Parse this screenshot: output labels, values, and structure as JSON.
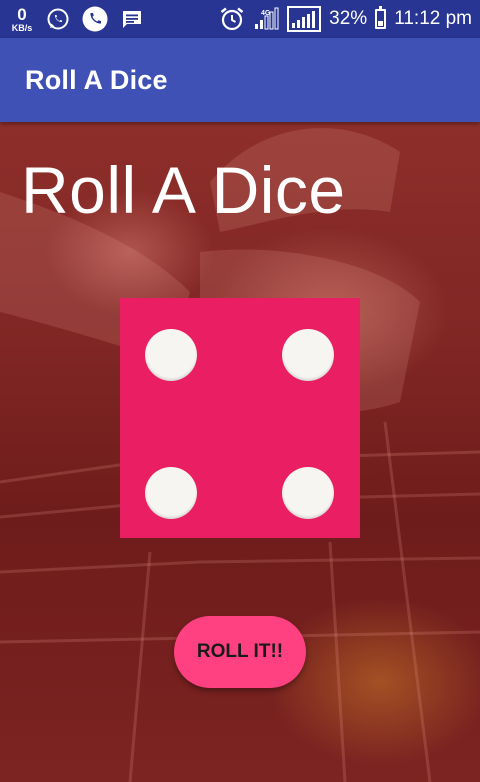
{
  "status_bar": {
    "net_speed_value": "0",
    "net_speed_unit": "KB/s",
    "left_icons": [
      "whatsapp-icon",
      "phone-icon",
      "message-icon"
    ],
    "right_icons": [
      "alarm-icon",
      "4g-signal-icon",
      "signal-icon",
      "battery-icon"
    ],
    "battery_percent": "32%",
    "time": "11:12 pm"
  },
  "app_bar": {
    "title": "Roll A Dice"
  },
  "main": {
    "heading": "Roll A Dice",
    "dice_face": 4,
    "button_label": "ROLL IT!!"
  },
  "colors": {
    "status_bar": "#283593",
    "app_bar": "#3f51b5",
    "dice": "#e91e63",
    "pip": "#f7f5f2",
    "button": "#ff4081"
  }
}
